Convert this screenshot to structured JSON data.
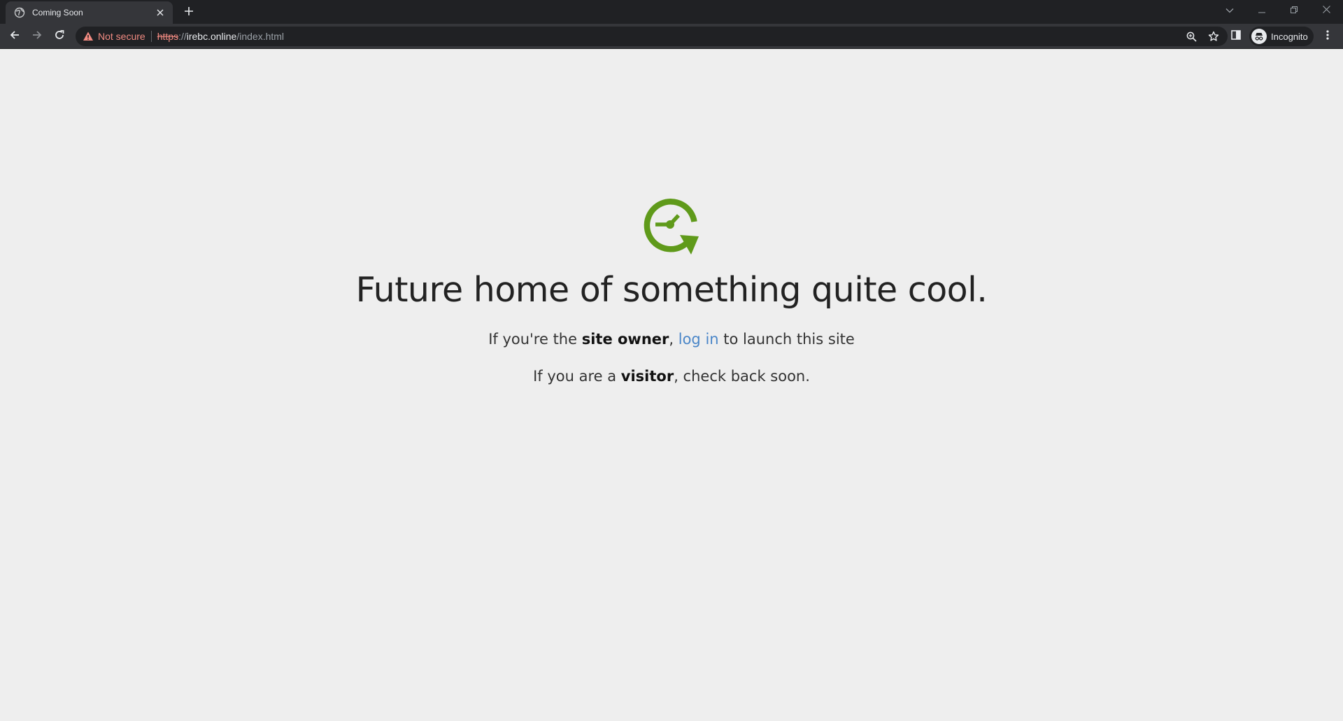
{
  "browser": {
    "tab": {
      "title": "Coming Soon",
      "favicon": "globe-icon"
    },
    "address": {
      "security_label": "Not secure",
      "url_scheme": "https",
      "url_separator": "://",
      "url_host": "irebc.online",
      "url_path": "/index.html"
    },
    "profile_label": "Incognito"
  },
  "page": {
    "logo": "clock-refresh-icon",
    "headline": "Future home of something quite cool.",
    "owner_line": {
      "prefix": "If you're the ",
      "bold": "site owner",
      "comma": ", ",
      "link": "log in",
      "suffix": " to launch this site"
    },
    "visitor_line": {
      "prefix": "If you are a ",
      "bold": "visitor",
      "suffix": ", check back soon."
    }
  },
  "colors": {
    "logo_green": "#5f9a1a",
    "link_blue": "#4a86c8",
    "page_bg": "#eeeeee"
  }
}
